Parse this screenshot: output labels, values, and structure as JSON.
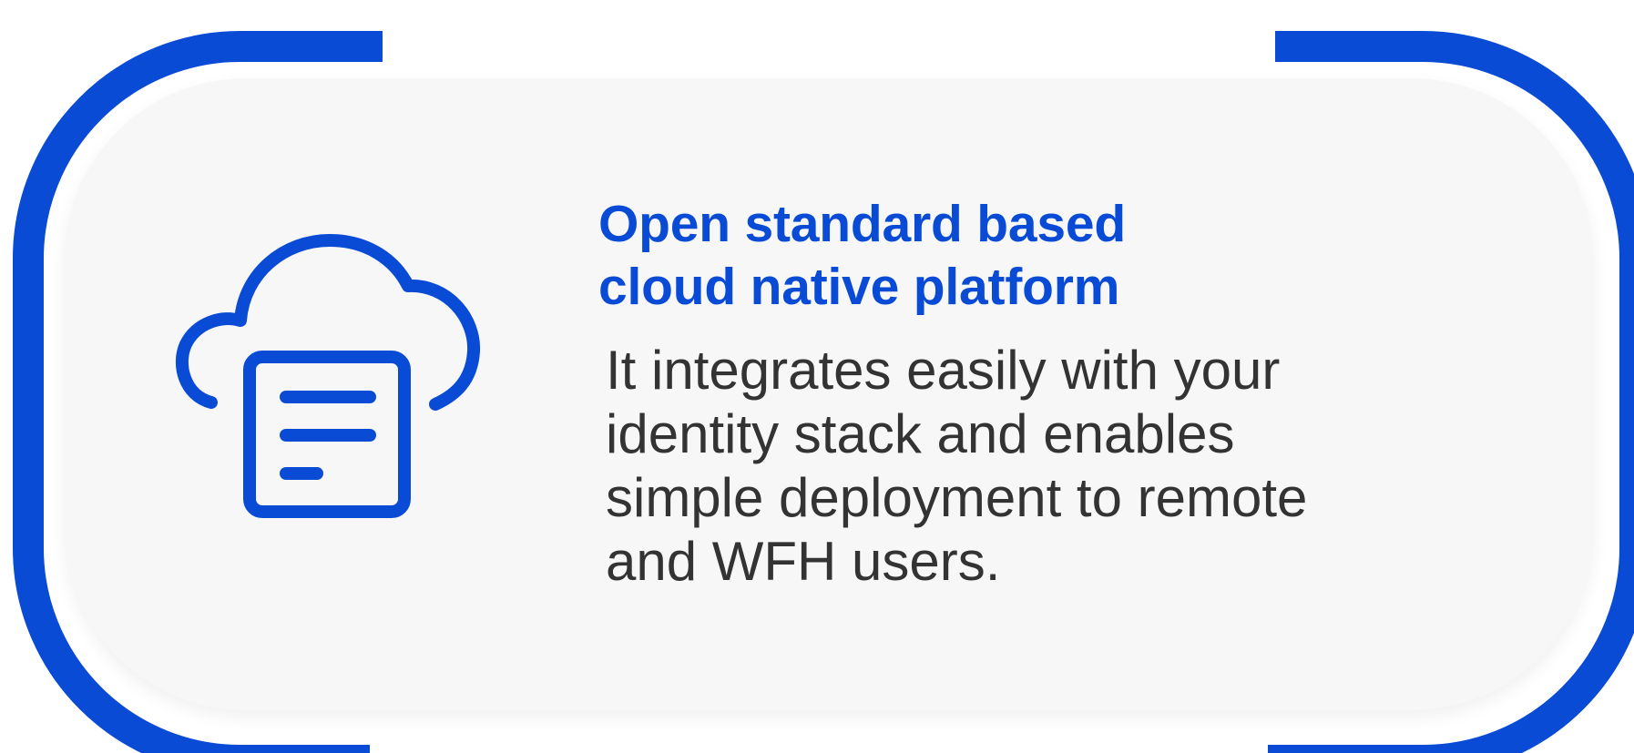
{
  "colors": {
    "accent": "#0a4bd6",
    "panel": "#f7f7f8",
    "text": "#333333"
  },
  "icon": "cloud-document-icon",
  "title": {
    "line1": "Open standard based",
    "line2": "cloud native platform"
  },
  "description": {
    "line1": "It integrates easily with your",
    "line2": "identity stack and enables",
    "line3": "simple deployment to remote",
    "line4": "and WFH users."
  }
}
